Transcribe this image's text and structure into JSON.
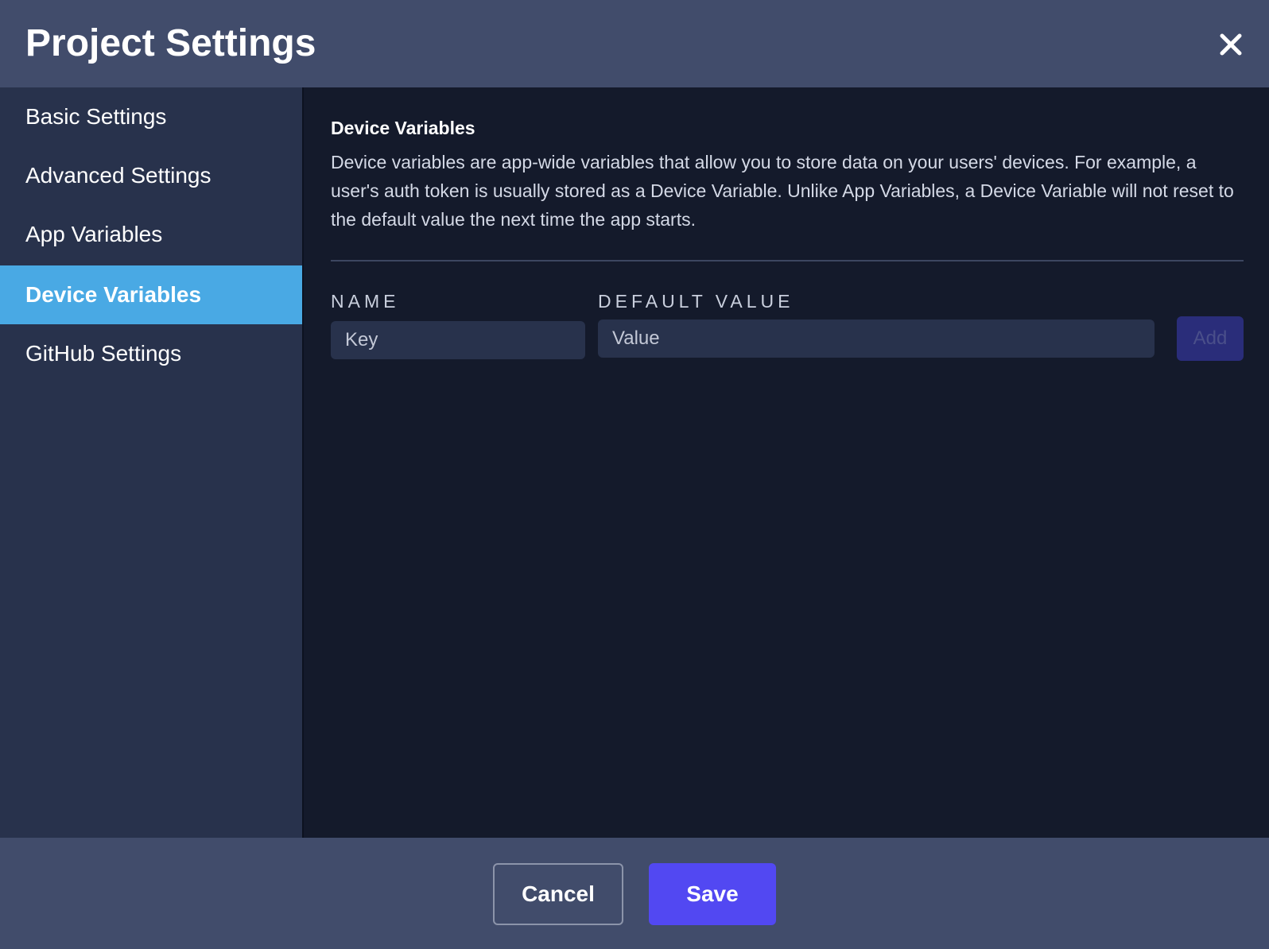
{
  "header": {
    "title": "Project Settings",
    "close_icon": "close-icon"
  },
  "sidebar": {
    "items": [
      {
        "label": "Basic Settings",
        "active": false
      },
      {
        "label": "Advanced Settings",
        "active": false
      },
      {
        "label": "App Variables",
        "active": false
      },
      {
        "label": "Device Variables",
        "active": true
      },
      {
        "label": "GitHub Settings",
        "active": false
      }
    ]
  },
  "main": {
    "section_title": "Device Variables",
    "description": "Device variables are app-wide variables that allow you to store data on your users' devices. For example, a user's auth token is usually stored as a Device Variable. Unlike App Variables, a Device Variable will not reset to the default value the next time the app starts.",
    "name_label": "NAME",
    "default_value_label": "DEFAULT VALUE",
    "key_input": {
      "value": "",
      "placeholder": "Key"
    },
    "value_input": {
      "value": "",
      "placeholder": "Value"
    },
    "add_label": "Add"
  },
  "footer": {
    "cancel_label": "Cancel",
    "save_label": "Save"
  },
  "colors": {
    "header_bg": "#414c6b",
    "sidebar_bg": "#28324c",
    "active_item": "#49a9e4",
    "main_bg": "#141a2b",
    "primary": "#5248f2",
    "add_disabled": "#2a2d7a"
  }
}
